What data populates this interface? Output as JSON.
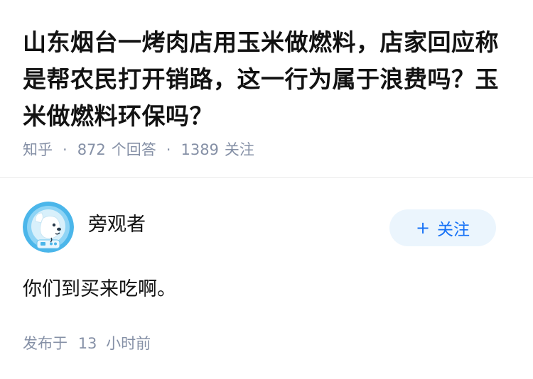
{
  "question": {
    "title": "山东烟台一烤肉店用玉米做燃料，店家回应称是帮农民打开销路，这一行为属于浪费吗？玉米做燃料环保吗？",
    "source": "知乎",
    "answer_count": "872",
    "answer_label": "个回答",
    "follower_count": "1389",
    "follower_label": "关注",
    "separator": "·"
  },
  "answer": {
    "author_name": "旁观者",
    "avatar_icon": "astronaut-dog-avatar",
    "follow_plus": "+",
    "follow_label": "关注",
    "content": "你们到买来吃啊。",
    "time_prefix": "发布于",
    "time_value": "13",
    "time_suffix": "小时前"
  },
  "colors": {
    "text_primary": "#121212",
    "text_secondary": "#8590a6",
    "accent_blue": "#1772f6",
    "follow_bg": "#ebf5fd",
    "divider": "#ebebeb",
    "avatar_bg": "#4bb6ea"
  }
}
